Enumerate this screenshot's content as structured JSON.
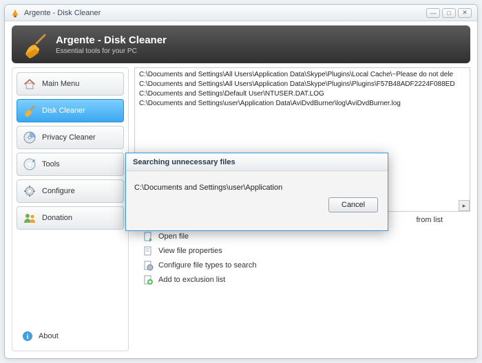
{
  "window": {
    "title": "Argente - Disk Cleaner"
  },
  "header": {
    "title": "Argente - Disk Cleaner",
    "subtitle": "Essential tools for your PC"
  },
  "sidebar": {
    "items": [
      {
        "label": "Main Menu"
      },
      {
        "label": "Disk Cleaner"
      },
      {
        "label": "Privacy Cleaner"
      },
      {
        "label": "Tools"
      },
      {
        "label": "Configure"
      },
      {
        "label": "Donation"
      }
    ],
    "about": "About"
  },
  "file_list": [
    "C:\\Documents and Settings\\All Users\\Application Data\\Skype\\Plugins\\Local Cache\\~Please do not dele",
    "C:\\Documents and Settings\\All Users\\Application Data\\Skype\\Plugins\\Plugins\\F57B48ADF2224F088ED",
    "C:\\Documents and Settings\\Default User\\NTUSER.DAT.LOG",
    "C:\\Documents and Settings\\user\\Application Data\\AviDvdBurner\\log\\AviDvdBurner.log"
  ],
  "from_list_text": "from list",
  "actions": [
    {
      "label": "Open file"
    },
    {
      "label": "View file properties"
    },
    {
      "label": "Configure file types to search"
    },
    {
      "label": "Add to exclusion list"
    }
  ],
  "dialog": {
    "title": "Searching unnecessary files",
    "path": "C:\\Documents and Settings\\user\\Application",
    "cancel": "Cancel"
  }
}
